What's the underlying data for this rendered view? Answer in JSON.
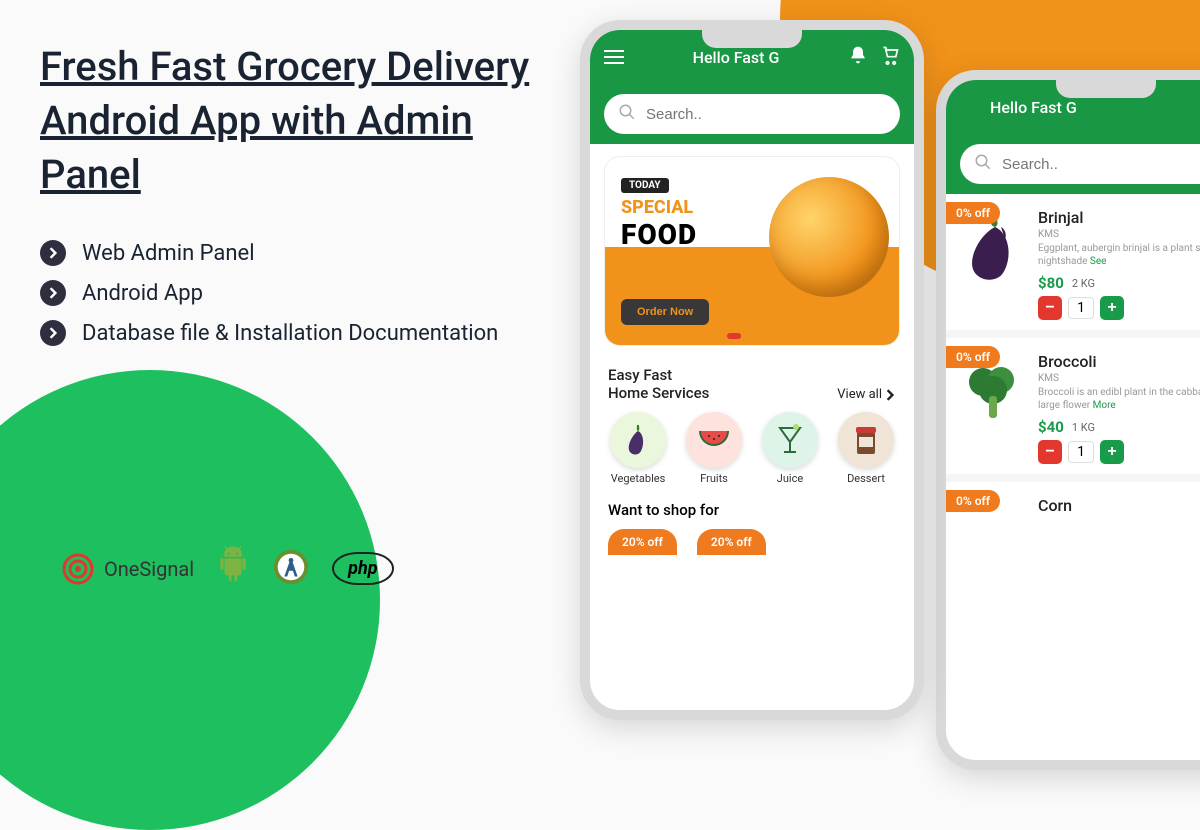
{
  "colors": {
    "green": "#199744",
    "orange": "#f1921a",
    "lime": "#1dbf5f",
    "red": "#e1372d"
  },
  "marketing": {
    "headline": "Fresh Fast Grocery Delivery Android App with Admin Panel",
    "features": [
      "Web Admin Panel",
      "Android App",
      "Database file & Installation Documentation"
    ],
    "tech": {
      "onesignal": "OneSignal",
      "android": "Android",
      "android_studio": "Android Studio",
      "php": "php"
    }
  },
  "app": {
    "greeting": "Hello Fast G",
    "search_placeholder": "Search..",
    "promo": {
      "today": "TODAY",
      "special": "SPECIAL",
      "food": "FOOD",
      "order": "Order Now"
    },
    "section_title": "Easy Fast\nHome Services",
    "view_all": "View all",
    "categories": [
      {
        "label": "Vegetables",
        "icon": "eggplant",
        "bg": "#eaf7dd"
      },
      {
        "label": "Fruits",
        "icon": "watermelon",
        "bg": "#fde2dd"
      },
      {
        "label": "Juice",
        "icon": "cocktail",
        "bg": "#dff4e8"
      },
      {
        "label": "Dessert",
        "icon": "jam",
        "bg": "#efe4d5"
      }
    ],
    "shop_title": "Want to shop for",
    "tags": [
      "20% off",
      "20% off"
    ]
  },
  "products": [
    {
      "discount": "0% off",
      "name": "Brinjal",
      "sub": "KMS",
      "desc": "Eggplant, aubergin brinjal is a plant sp the nightshade",
      "more": "See",
      "price": "$80",
      "weight": "2 KG",
      "qty": "1",
      "img": "eggplant"
    },
    {
      "discount": "0% off",
      "name": "Broccoli",
      "sub": "KMS",
      "desc": "Broccoli is an edibl plant in the cabbag whose large flower",
      "more": "More",
      "price": "$40",
      "weight": "1 KG",
      "qty": "1",
      "img": "broccoli"
    },
    {
      "discount": "0% off",
      "name": "Corn",
      "sub": "",
      "desc": "",
      "more": "",
      "price": "",
      "weight": "",
      "qty": "",
      "img": ""
    }
  ]
}
